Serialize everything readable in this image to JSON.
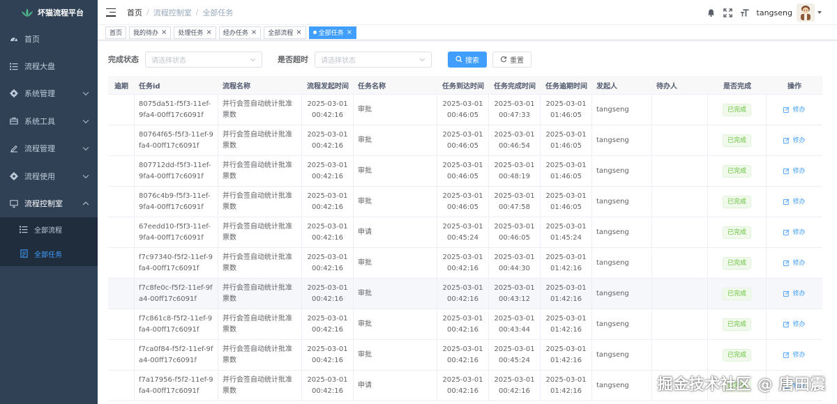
{
  "app": {
    "title": "坏猫流程平台"
  },
  "sidebar": {
    "items": [
      {
        "label": "首页",
        "icon": "dashboard-icon",
        "has_children": false
      },
      {
        "label": "流程大盘",
        "icon": "list-icon",
        "has_children": false
      },
      {
        "label": "系统管理",
        "icon": "gear-icon",
        "has_children": true
      },
      {
        "label": "系统工具",
        "icon": "toolbox-icon",
        "has_children": true
      },
      {
        "label": "流程管理",
        "icon": "edit-icon",
        "has_children": true
      },
      {
        "label": "流程使用",
        "icon": "gear-icon",
        "has_children": true
      },
      {
        "label": "流程控制室",
        "icon": "monitor-icon",
        "has_children": true,
        "expanded": true
      }
    ],
    "sub_items": [
      {
        "label": "全部流程",
        "icon": "list-icon",
        "active": false
      },
      {
        "label": "全部任务",
        "icon": "document-icon",
        "active": true
      }
    ]
  },
  "header": {
    "breadcrumb": [
      "首页",
      "流程控制室",
      "全部任务"
    ],
    "username": "tangseng"
  },
  "tags": [
    {
      "label": "首页",
      "closable": false,
      "active": false
    },
    {
      "label": "我的待办",
      "closable": true,
      "active": false
    },
    {
      "label": "处理任务",
      "closable": true,
      "active": false
    },
    {
      "label": "经办任务",
      "closable": true,
      "active": false
    },
    {
      "label": "全部流程",
      "closable": true,
      "active": false
    },
    {
      "label": "全部任务",
      "closable": true,
      "active": true
    }
  ],
  "search": {
    "status_label": "完成状态",
    "status_placeholder": "请选择状态",
    "overdue_label": "是否超时",
    "overdue_placeholder": "请选择状态",
    "search_button": "搜索",
    "reset_button": "重置"
  },
  "table": {
    "columns": [
      "逾期",
      "任务id",
      "流程名称",
      "流程发起时间",
      "任务名称",
      "任务到达时间",
      "任务完成时间",
      "任务逾期时间",
      "发起人",
      "待办人",
      "是否完成",
      "操作"
    ],
    "rows": [
      {
        "overdue": "",
        "id": "8075da51-f5f3-11ef-9fa4-00ff17c6091f",
        "flow": "并行会签自动统计批准票数",
        "start": "2025-03-01 00:42:16",
        "task": "审批",
        "arrive": "2025-03-01 00:46:05",
        "complete": "2025-03-01 00:47:33",
        "due": "2025-03-01 01:46:05",
        "initiator": "tangseng",
        "assignee": "",
        "done": "已完成",
        "action": "修办"
      },
      {
        "overdue": "",
        "id": "80764f65-f5f3-11ef-9fa4-00ff17c6091f",
        "flow": "并行会签自动统计批准票数",
        "start": "2025-03-01 00:42:16",
        "task": "审批",
        "arrive": "2025-03-01 00:46:05",
        "complete": "2025-03-01 00:46:54",
        "due": "2025-03-01 01:46:05",
        "initiator": "tangseng",
        "assignee": "",
        "done": "已完成",
        "action": "修办"
      },
      {
        "overdue": "",
        "id": "807712dd-f5f3-11ef-9fa4-00ff17c6091f",
        "flow": "并行会签自动统计批准票数",
        "start": "2025-03-01 00:42:16",
        "task": "审批",
        "arrive": "2025-03-01 00:46:05",
        "complete": "2025-03-01 00:48:19",
        "due": "2025-03-01 01:46:05",
        "initiator": "tangseng",
        "assignee": "",
        "done": "已完成",
        "action": "修办"
      },
      {
        "overdue": "",
        "id": "8076c4b9-f5f3-11ef-9fa4-00ff17c6091f",
        "flow": "并行会签自动统计批准票数",
        "start": "2025-03-01 00:42:16",
        "task": "审批",
        "arrive": "2025-03-01 00:46:05",
        "complete": "2025-03-01 00:47:58",
        "due": "2025-03-01 01:46:05",
        "initiator": "tangseng",
        "assignee": "",
        "done": "已完成",
        "action": "修办"
      },
      {
        "overdue": "",
        "id": "67eedd10-f5f3-11ef-9fa4-00ff17c6091f",
        "flow": "并行会签自动统计批准票数",
        "start": "2025-03-01 00:42:16",
        "task": "申请",
        "arrive": "2025-03-01 00:45:24",
        "complete": "2025-03-01 00:46:05",
        "due": "2025-03-01 01:45:24",
        "initiator": "tangseng",
        "assignee": "",
        "done": "已完成",
        "action": "修办"
      },
      {
        "overdue": "",
        "id": "f7c97340-f5f2-11ef-9fa4-00ff17c6091f",
        "flow": "并行会签自动统计批准票数",
        "start": "2025-03-01 00:42:16",
        "task": "审批",
        "arrive": "2025-03-01 00:42:16",
        "complete": "2025-03-01 00:44:30",
        "due": "2025-03-01 01:42:16",
        "initiator": "tangseng",
        "assignee": "",
        "done": "已完成",
        "action": "修办"
      },
      {
        "overdue": "",
        "id": "f7c8fe0c-f5f2-11ef-9fa4-00ff17c6091f",
        "flow": "并行会签自动统计批准票数",
        "start": "2025-03-01 00:42:16",
        "task": "审批",
        "arrive": "2025-03-01 00:42:16",
        "complete": "2025-03-01 00:43:12",
        "due": "2025-03-01 01:42:16",
        "initiator": "tangseng",
        "assignee": "",
        "done": "已完成",
        "action": "修办"
      },
      {
        "overdue": "",
        "id": "f7c861c8-f5f2-11ef-9fa4-00ff17c6091f",
        "flow": "并行会签自动统计批准票数",
        "start": "2025-03-01 00:42:16",
        "task": "审批",
        "arrive": "2025-03-01 00:42:16",
        "complete": "2025-03-01 00:43:44",
        "due": "2025-03-01 01:42:16",
        "initiator": "tangseng",
        "assignee": "",
        "done": "已完成",
        "action": "修办"
      },
      {
        "overdue": "",
        "id": "f7ca0f84-f5f2-11ef-9fa4-00ff17c6091f",
        "flow": "并行会签自动统计批准票数",
        "start": "2025-03-01 00:42:16",
        "task": "审批",
        "arrive": "2025-03-01 00:42:16",
        "complete": "2025-03-01 00:45:24",
        "due": "2025-03-01 01:42:16",
        "initiator": "tangseng",
        "assignee": "",
        "done": "已完成",
        "action": "修办"
      },
      {
        "overdue": "",
        "id": "f7a17956-f5f2-11ef-9fa4-00ff17c6091f",
        "flow": "并行会签自动统计批准票数",
        "start": "2025-03-01 00:42:16",
        "task": "申请",
        "arrive": "2025-03-01 00:42:16",
        "complete": "2025-03-01 00:42:16",
        "due": "2025-03-01 01:42:16",
        "initiator": "tangseng",
        "assignee": "",
        "done": "已完成",
        "action": "修办"
      }
    ]
  },
  "watermark": "掘金技术社区 @ 唐田震",
  "colors": {
    "sidebar_bg": "#304156",
    "submenu_bg": "#1f2d3d",
    "primary": "#409eff",
    "success": "#67c23a"
  }
}
